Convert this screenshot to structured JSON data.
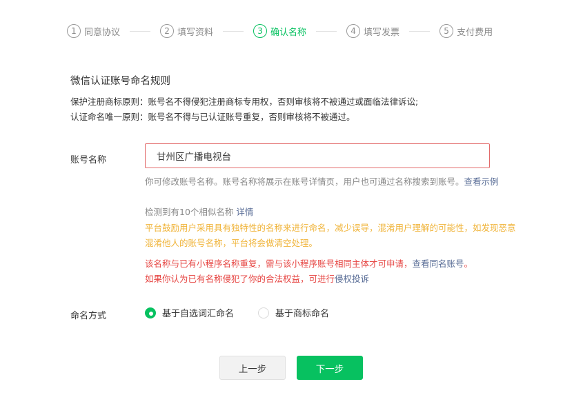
{
  "stepper": {
    "steps": [
      {
        "num": "1",
        "label": "同意协议"
      },
      {
        "num": "2",
        "label": "填写资料"
      },
      {
        "num": "3",
        "label": "确认名称"
      },
      {
        "num": "4",
        "label": "填写发票"
      },
      {
        "num": "5",
        "label": "支付费用"
      }
    ],
    "active_index": 2
  },
  "rules": {
    "title": "微信认证账号命名规则",
    "line1": "保护注册商标原则：账号名不得侵犯注册商标专用权，否则审核将不被通过或面临法律诉讼;",
    "line2": "认证命名唯一原则：账号名不得与已认证账号重复，否则审核将不被通过。"
  },
  "form": {
    "name_label": "账号名称",
    "name_value": "甘州区广播电视台",
    "hint_desc": "你可修改账号名称。账号名称将展示在账号详情页，用户也可通过名称搜索到账号。",
    "hint_desc_link": "查看示例",
    "hint_similar": "检测到有10个相似名称",
    "hint_similar_link": "详情",
    "hint_warn": "平台鼓励用户采用具有独特性的名称来进行命名，减少误导，混淆用户理解的可能性，如发现恶意混淆他人的账号名称，平台将会做清空处理。",
    "hint_err_1": "该名称与已有小程序名称重复，需与该小程序账号相同主体才可申请，",
    "hint_err_1_link": "查看同名账号",
    "hint_err_1_end": "。",
    "hint_err_2": "如果你认为已有名称侵犯了你的合法权益，可进行",
    "hint_err_2_link": "侵权投诉",
    "mode_label": "命名方式",
    "mode_options": [
      "基于自选词汇命名",
      "基于商标命名"
    ],
    "mode_selected": 0
  },
  "buttons": {
    "prev": "上一步",
    "next": "下一步"
  },
  "colors": {
    "accent": "#07c160",
    "error": "#e64340",
    "warning": "#f0b43a",
    "link": "#576b95"
  }
}
